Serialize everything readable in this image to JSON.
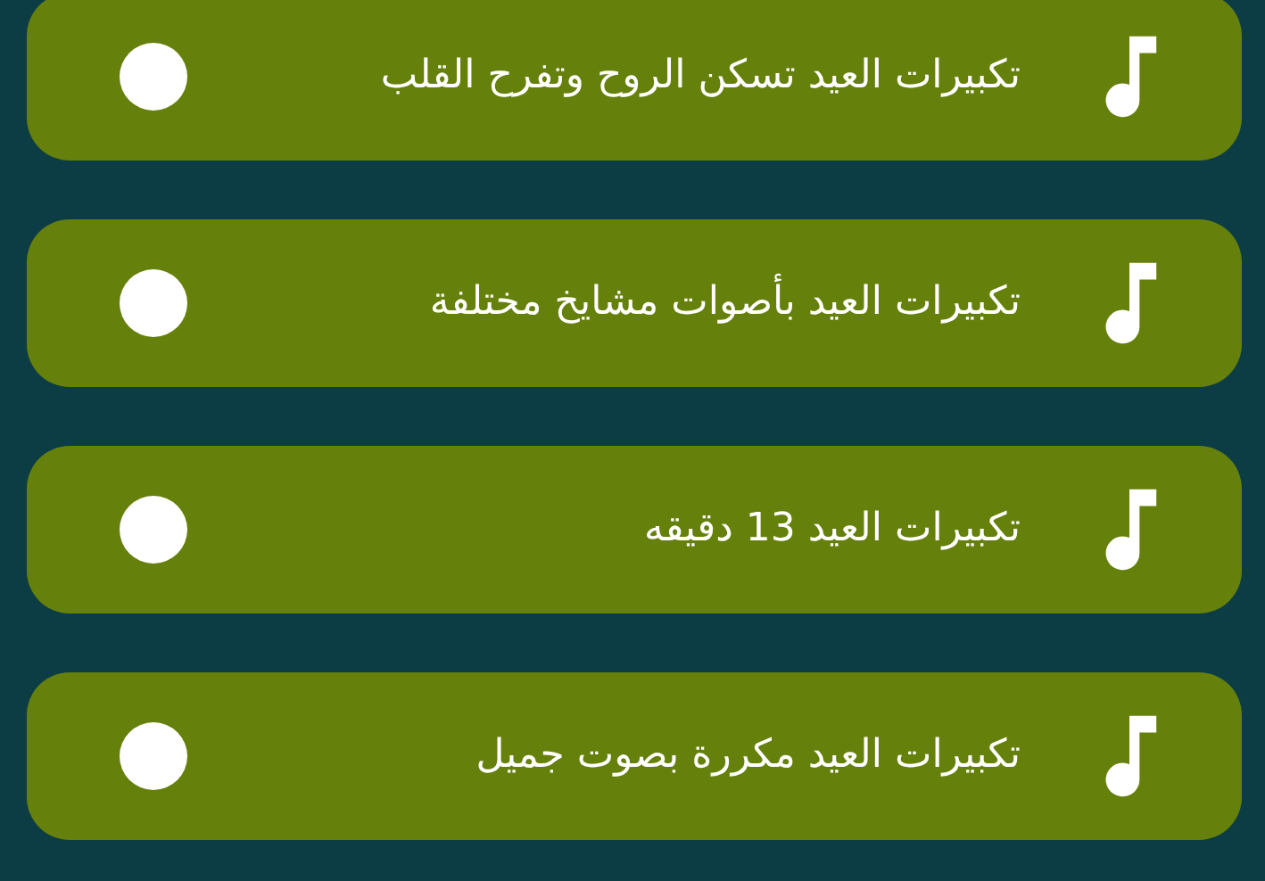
{
  "tracks": [
    {
      "title": "تكبيرات العيد تسكن الروح وتفرح القلب"
    },
    {
      "title": "تكبيرات العيد بأصوات مشايخ مختلفة"
    },
    {
      "title": "تكبيرات العيد 13 دقيقه"
    },
    {
      "title": "تكبيرات العيد مكررة بصوت جميل"
    }
  ]
}
